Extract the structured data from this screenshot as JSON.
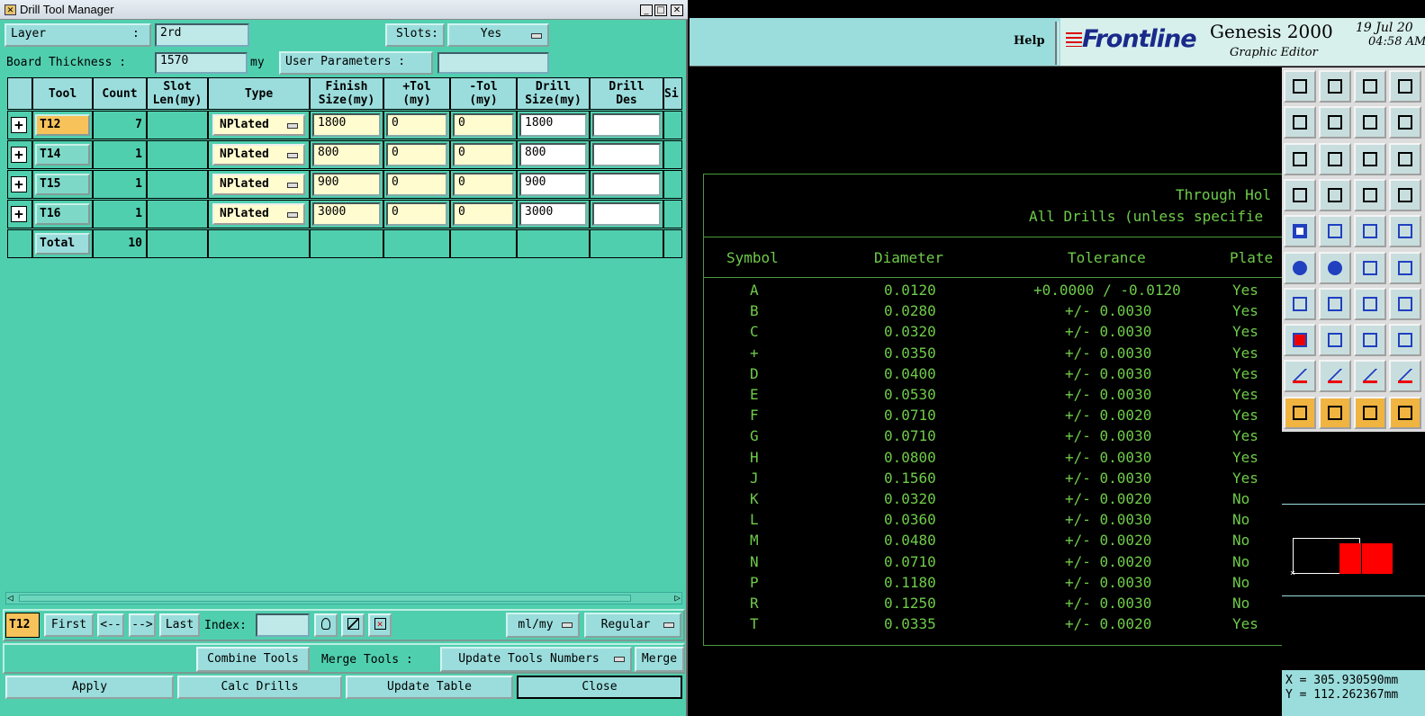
{
  "dialog": {
    "title": "Drill Tool Manager",
    "layer_label": "Layer",
    "layer_colon": ":",
    "layer_value": "2rd",
    "slots_label": "Slots:",
    "slots_value": "Yes",
    "board_thickness_label": "Board Thickness :",
    "board_thickness_value": "1570",
    "board_thickness_unit": "my",
    "user_params_label": "User Parameters :",
    "user_params_value": ""
  },
  "table": {
    "headers": [
      "",
      "Tool",
      "Count",
      "Slot\nLen(my)",
      "Type",
      "Finish\nSize(my)",
      "+Tol\n(my)",
      "-Tol\n(my)",
      "Drill\nSize(my)",
      "Drill\nDes",
      "Si"
    ],
    "rows": [
      {
        "tool": "T12",
        "count": "7",
        "type": "NPlated",
        "finish": "1800",
        "ptol": "0",
        "ntol": "0",
        "drill": "1800",
        "des": ""
      },
      {
        "tool": "T14",
        "count": "1",
        "type": "NPlated",
        "finish": "800",
        "ptol": "0",
        "ntol": "0",
        "drill": "800",
        "des": ""
      },
      {
        "tool": "T15",
        "count": "1",
        "type": "NPlated",
        "finish": "900",
        "ptol": "0",
        "ntol": "0",
        "drill": "900",
        "des": ""
      },
      {
        "tool": "T16",
        "count": "1",
        "type": "NPlated",
        "finish": "3000",
        "ptol": "0",
        "ntol": "0",
        "drill": "3000",
        "des": ""
      }
    ],
    "total_label": "Total",
    "total_count": "10"
  },
  "nav": {
    "current": "T12",
    "first": "First",
    "prev": "<--",
    "next": "-->",
    "last": "Last",
    "index_label": "Index:",
    "index_value": "",
    "units": "ml/my",
    "mode": "Regular"
  },
  "actions": {
    "combine": "Combine Tools",
    "merge_label": "Merge Tools :",
    "merge_option": "Update Tools Numbers",
    "merge": "Merge",
    "apply": "Apply",
    "calc": "Calc Drills",
    "update": "Update Table",
    "close": "Close"
  },
  "editor": {
    "help": "Help",
    "brand": "Frontline",
    "product": "Genesis 2000",
    "subtitle": "Graphic Editor",
    "date": "19 Jul 20",
    "time": "04:58 AM"
  },
  "drill_chart": {
    "title1": "Through Hol",
    "title2": "All Drills (unless specifie",
    "col_symbol": "Symbol",
    "col_diameter": "Diameter",
    "col_tolerance": "Tolerance",
    "col_plated": "Plate",
    "rows": [
      {
        "s": "A",
        "d": "0.0120",
        "t": "+0.0000 / -0.0120",
        "p": "Yes"
      },
      {
        "s": "B",
        "d": "0.0280",
        "t": "+/- 0.0030",
        "p": "Yes"
      },
      {
        "s": "C",
        "d": "0.0320",
        "t": "+/- 0.0030",
        "p": "Yes"
      },
      {
        "s": "+",
        "d": "0.0350",
        "t": "+/- 0.0030",
        "p": "Yes"
      },
      {
        "s": "D",
        "d": "0.0400",
        "t": "+/- 0.0030",
        "p": "Yes"
      },
      {
        "s": "E",
        "d": "0.0530",
        "t": "+/- 0.0030",
        "p": "Yes"
      },
      {
        "s": "F",
        "d": "0.0710",
        "t": "+/- 0.0020",
        "p": "Yes"
      },
      {
        "s": "G",
        "d": "0.0710",
        "t": "+/- 0.0030",
        "p": "Yes"
      },
      {
        "s": "H",
        "d": "0.0800",
        "t": "+/- 0.0030",
        "p": "Yes"
      },
      {
        "s": "J",
        "d": "0.1560",
        "t": "+/- 0.0030",
        "p": "Yes"
      },
      {
        "s": "K",
        "d": "0.0320",
        "t": "+/- 0.0020",
        "p": "No"
      },
      {
        "s": "L",
        "d": "0.0360",
        "t": "+/- 0.0030",
        "p": "No"
      },
      {
        "s": "M",
        "d": "0.0480",
        "t": "+/- 0.0020",
        "p": "No"
      },
      {
        "s": "N",
        "d": "0.0710",
        "t": "+/- 0.0020",
        "p": "No"
      },
      {
        "s": "P",
        "d": "0.1180",
        "t": "+/- 0.0030",
        "p": "No"
      },
      {
        "s": "R",
        "d": "0.1250",
        "t": "+/- 0.0030",
        "p": "No"
      },
      {
        "s": "T",
        "d": "0.0335",
        "t": "+/- 0.0020",
        "p": "Yes"
      }
    ]
  },
  "coords": {
    "x": "X = 305.930590mm",
    "y": "Y = 112.262367mm"
  },
  "colors": {
    "dialog_bg": "#50cfaf",
    "chart_green": "#6fcb4a",
    "highlight": "#f8c25a"
  }
}
